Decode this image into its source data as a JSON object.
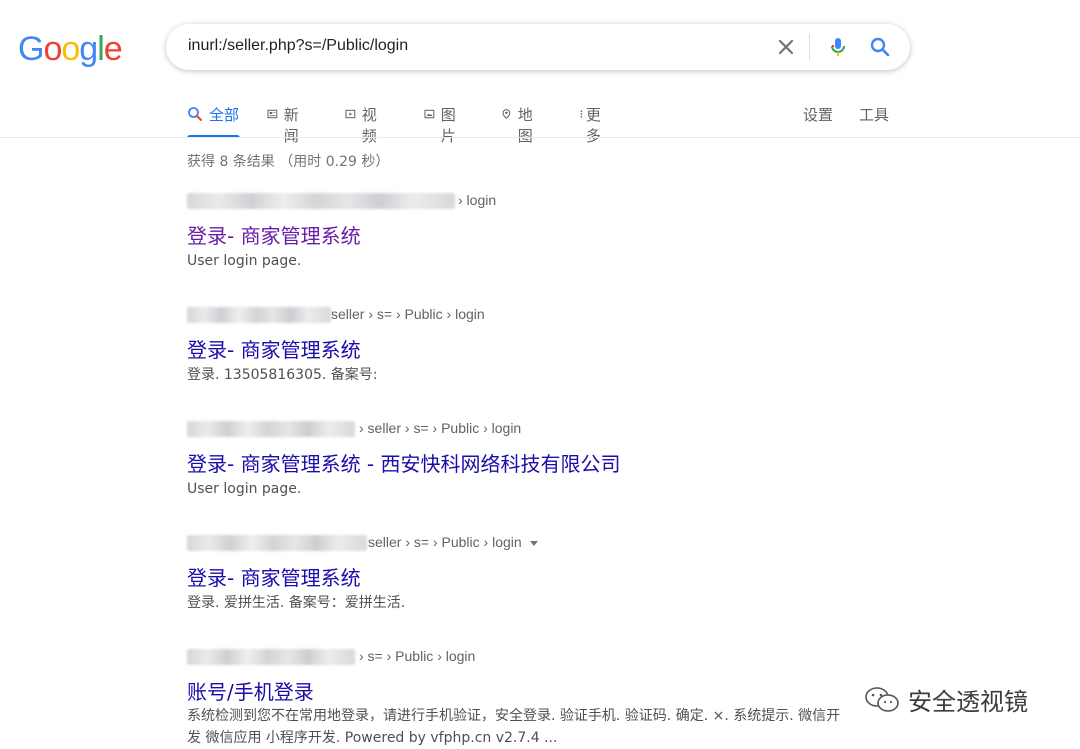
{
  "logo": {
    "letters": [
      "G",
      "o",
      "o",
      "g",
      "l",
      "e"
    ],
    "colors": [
      "#4285f4",
      "#ea4335",
      "#fbbc05",
      "#4285f4",
      "#34a853",
      "#ea4335"
    ]
  },
  "search": {
    "query": "inurl:/seller.php?s=/Public/login"
  },
  "tabs": [
    {
      "label": "全部",
      "icon": "search-icon"
    },
    {
      "label": "新闻",
      "icon": "news-icon"
    },
    {
      "label": "视频",
      "icon": "video-icon"
    },
    {
      "label": "图片",
      "icon": "image-icon"
    },
    {
      "label": "地图",
      "icon": "map-pin-icon"
    },
    {
      "label": "更多",
      "icon": "more-vert-icon"
    }
  ],
  "tools": {
    "settings": "设置",
    "tools": "工具"
  },
  "stats": "获得 8 条结果 （用时 0.29 秒）",
  "results": [
    {
      "crumb": "› login",
      "title": "登录- 商家管理系统",
      "snippet": "User login page."
    },
    {
      "crumb": "seller › s= › Public › login",
      "title": "登录- 商家管理系统",
      "snippet": "登录. 13505816305. 备案号:"
    },
    {
      "crumb": "› seller › s= › Public › login",
      "title": "登录- 商家管理系统 - 西安快科网络科技有限公司",
      "snippet": "User login page."
    },
    {
      "crumb": "seller › s= › Public › login",
      "title": "登录- 商家管理系统",
      "snippet": "登录. 爱拼生活. 备案号：爱拼生活."
    },
    {
      "crumb": "› s= › Public › login",
      "title": "账号/手机登录",
      "snippet": "系统检测到您不在常用地登录，请进行手机验证，安全登录. 验证手机. 验证码. 确定. ×. 系统提示. 微信开发 微信应用 小程序开发. Powered by vfphp.cn v2.7.4 ..."
    }
  ],
  "watermark": {
    "text": "安全透视镜"
  },
  "colors": {
    "link": "#1a0dab",
    "visited": "#681da8",
    "accent": "#1a73e8"
  }
}
